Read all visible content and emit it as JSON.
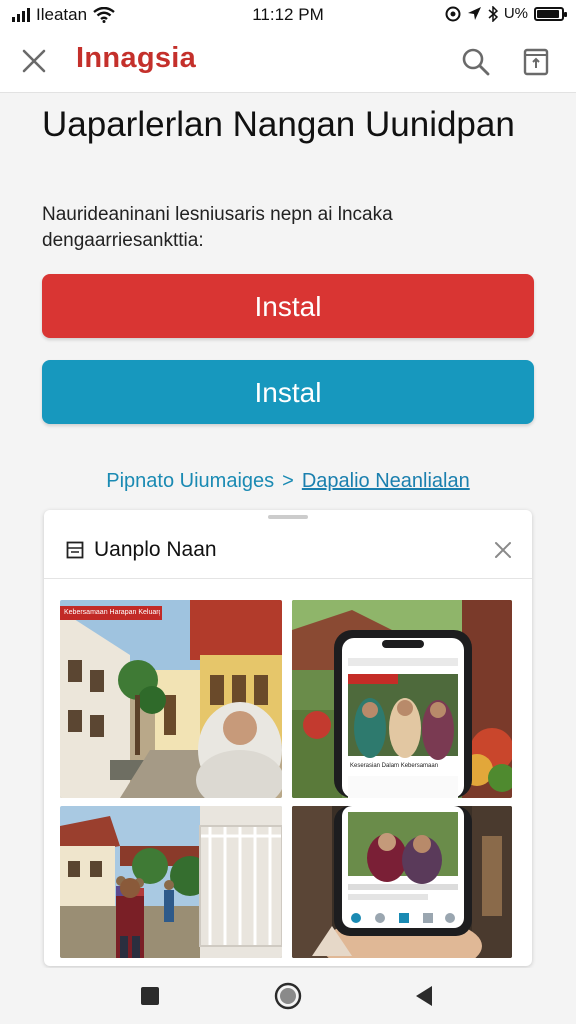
{
  "status_bar": {
    "carrier": "Ileatan",
    "time": "11:12 PM",
    "battery_text": "U%",
    "icons": [
      "signal-icon",
      "wifi-icon",
      "at-icon",
      "location-icon",
      "bluetooth-icon",
      "battery-icon"
    ]
  },
  "header": {
    "title": "Innagsia",
    "close_icon": "close-icon",
    "search_icon": "search-icon",
    "share_icon": "share-icon",
    "title_color": "#c4302b"
  },
  "content": {
    "headline": "Uaparlerlan Nangan Uunidpan",
    "description": "Naurideaninani lesniusaris nepn ai lncaka dengaarriesankttia:",
    "primary_button": {
      "label": "Instal",
      "color": "#d93533"
    },
    "secondary_button": {
      "label": "Instal",
      "color": "#1798be"
    },
    "breadcrumb": {
      "first": "Pipnato Uiumaiges",
      "separator": ">",
      "second": "Dapalio Neanlialan"
    }
  },
  "card": {
    "title": "Uanplo Naan",
    "doc_icon": "document-icon",
    "close_icon": "close-icon",
    "photos": [
      {
        "name": "photo-building-woman",
        "banner_text": "Kebersamaan Harapan Keluarga"
      },
      {
        "name": "photo-phone-app",
        "phone_caption": "Keserasian Dalam Kebersamaan"
      },
      {
        "name": "photo-courtyard-people"
      },
      {
        "name": "photo-hand-phone"
      }
    ]
  },
  "nav": {
    "icons": [
      "recent-apps-icon",
      "home-icon",
      "back-icon"
    ]
  }
}
